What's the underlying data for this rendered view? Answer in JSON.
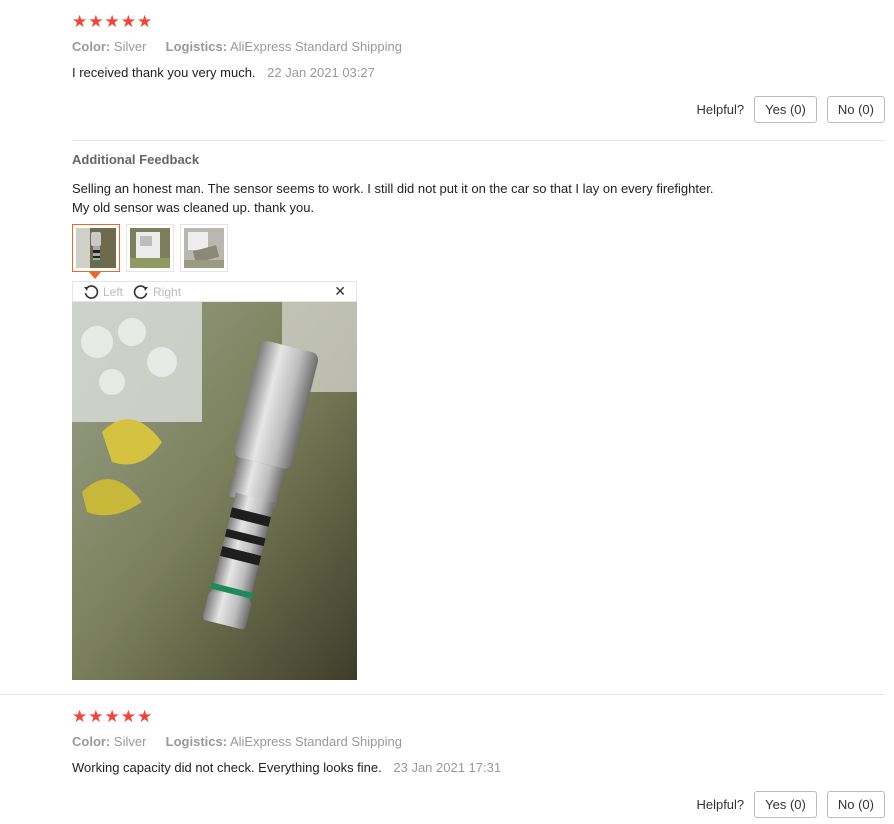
{
  "reviews": [
    {
      "stars": "★★★★★",
      "color_label": "Color:",
      "color_value": "Silver",
      "logistics_label": "Logistics:",
      "logistics_value": "AliExpress Standard Shipping",
      "text": "I received thank you very much.",
      "date": "22 Jan 2021 03:27",
      "helpful_label": "Helpful?",
      "yes_label": "Yes (0)",
      "no_label": "No (0)"
    },
    {
      "stars": "★★★★★",
      "color_label": "Color:",
      "color_value": "Silver",
      "logistics_label": "Logistics:",
      "logistics_value": "AliExpress Standard Shipping",
      "text": "Working capacity did not check. Everything looks fine.",
      "date": "23 Jan 2021 17:31",
      "helpful_label": "Helpful?",
      "yes_label": "Yes (0)",
      "no_label": "No (0)"
    }
  ],
  "additional_feedback": {
    "title": "Additional Feedback",
    "line1": "Selling an honest man. The sensor seems to work. I still did not put it on the car so that I lay on every firefighter.",
    "line2": "My old sensor was cleaned up. thank you."
  },
  "viewer": {
    "rotate_left_label": "Left",
    "rotate_right_label": "Right",
    "close_glyph": "✕"
  },
  "colors": {
    "star": "#f0463a",
    "active_thumb": "#e76a2a"
  }
}
